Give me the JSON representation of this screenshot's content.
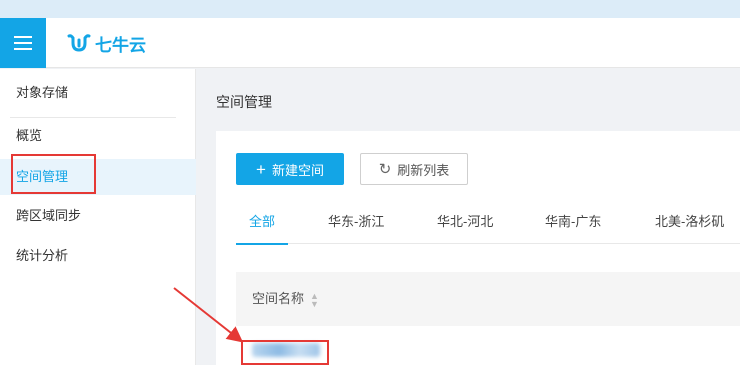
{
  "header": {
    "logo_text": "七牛云",
    "menu_icon": "hamburger-icon",
    "logo_icon": "qiniu-logo-icon"
  },
  "sidebar": {
    "items": [
      {
        "label": "对象存储"
      },
      {
        "label": "概览"
      },
      {
        "label": "空间管理",
        "active": true
      },
      {
        "label": "跨区域同步"
      },
      {
        "label": "统计分析"
      }
    ]
  },
  "main": {
    "page_title": "空间管理",
    "buttons": {
      "new_bucket": "新建空间",
      "refresh_list": "刷新列表"
    },
    "tabs": [
      {
        "label": "全部",
        "active": true
      },
      {
        "label": "华东-浙江"
      },
      {
        "label": "华北-河北"
      },
      {
        "label": "华南-广东"
      },
      {
        "label": "北美-洛杉矶"
      }
    ],
    "table": {
      "columns": [
        "空间名称"
      ],
      "rows": [
        {
          "name": "agnitoh"
        }
      ]
    }
  },
  "colors": {
    "accent": "#13a5e6",
    "highlight_box": "#e53935"
  }
}
